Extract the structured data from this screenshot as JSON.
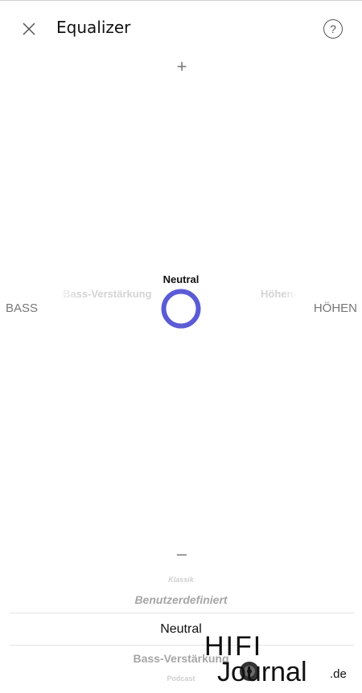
{
  "header": {
    "title": "Equalizer",
    "help_glyph": "?"
  },
  "icons": {
    "close": "close-icon",
    "help": "help-icon"
  },
  "controls": {
    "increase": "+",
    "decrease": "–"
  },
  "axis": {
    "left_label": "BASS",
    "right_label": "HÖHEN",
    "left_ghost": "Bass-Verstärkung",
    "right_ghost": "Höhen-"
  },
  "pad": {
    "current_preset": "Neutral",
    "handle_color": "#5b5bd6"
  },
  "presets": {
    "items": [
      "Klassik",
      "Benutzerdefiniert",
      "Neutral",
      "Bass-Verstärkung",
      "Podcast"
    ],
    "selected": "Neutral"
  },
  "watermark": {
    "brand_line1": "HIFI",
    "brand_line2": "Journal",
    "brand_suffix": ".de"
  }
}
